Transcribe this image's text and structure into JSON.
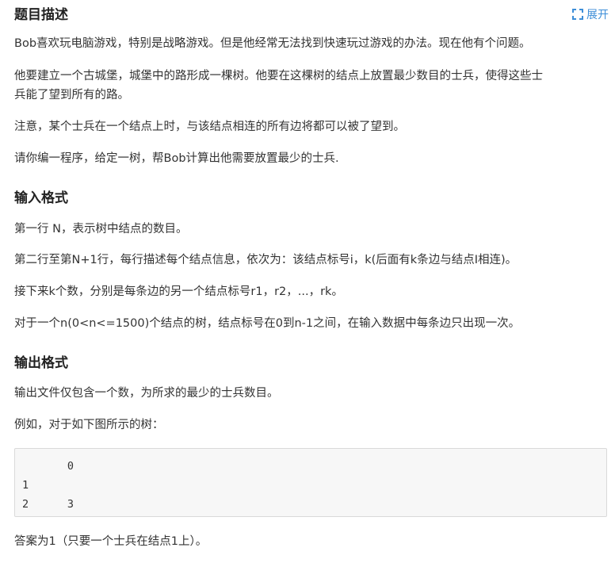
{
  "header": {
    "title": "题目描述",
    "expand_label": "展开"
  },
  "description": {
    "p1": "Bob喜欢玩电脑游戏，特别是战略游戏。但是他经常无法找到快速玩过游戏的办法。现在他有个问题。",
    "p2_line1": "他要建立一个古城堡，城堡中的路形成一棵树。他要在这棵树的结点上放置最少数目的士兵，使得这些士",
    "p2_line2": "兵能了望到所有的路。",
    "p3": "注意，某个士兵在一个结点上时，与该结点相连的所有边将都可以被了望到。",
    "p4": "请你编一程序，给定一树，帮Bob计算出他需要放置最少的士兵."
  },
  "input_format": {
    "title": "输入格式",
    "p1": "第一行 N，表示树中结点的数目。",
    "p2": "第二行至第N+1行，每行描述每个结点信息，依次为：该结点标号i，k(后面有k条边与结点I相连)。",
    "p3": "接下来k个数，分别是每条边的另一个结点标号r1，r2，...，rk。",
    "p4": "对于一个n(0<n<=1500)个结点的树，结点标号在0到n-1之间，在输入数据中每条边只出现一次。"
  },
  "output_format": {
    "title": "输出格式",
    "p1": "输出文件仅包含一个数，为所求的最少的士兵数目。",
    "p2": "例如，对于如下图所示的树：",
    "code": "       0\n1\n2      3",
    "p3": "答案为1（只要一个士兵在结点1上）。"
  }
}
